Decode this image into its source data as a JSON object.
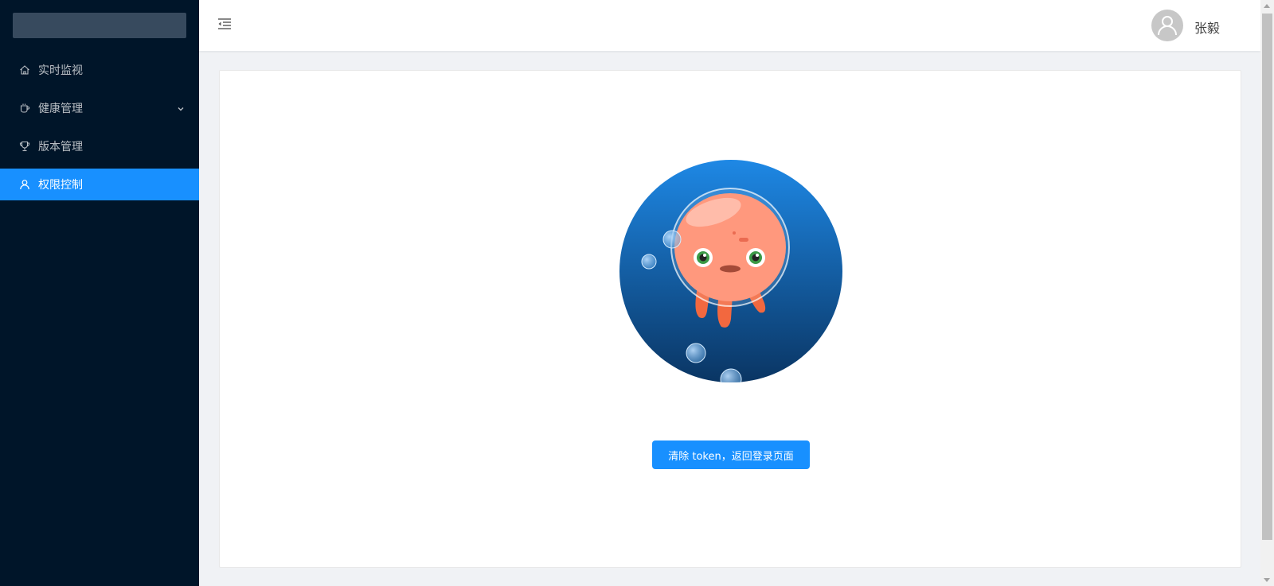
{
  "sidebar": {
    "items": [
      {
        "label": "实时监视",
        "icon": "home-icon",
        "active": false
      },
      {
        "label": "健康管理",
        "icon": "cup-icon",
        "active": false,
        "expandable": true
      },
      {
        "label": "版本管理",
        "icon": "trophy-icon",
        "active": false
      },
      {
        "label": "权限控制",
        "icon": "user-icon",
        "active": true
      }
    ]
  },
  "header": {
    "username": "张毅",
    "menu_fold_icon": "menu-fold-icon",
    "avatar_icon": "user-avatar-icon"
  },
  "main": {
    "illustration": "astronaut-octopus-in-bubble",
    "action_button": "清除 token，返回登录页面"
  },
  "colors": {
    "sidebar_bg": "#001529",
    "active_item": "#1890ff",
    "button": "#1890ff",
    "page_bg": "#f0f2f5"
  }
}
